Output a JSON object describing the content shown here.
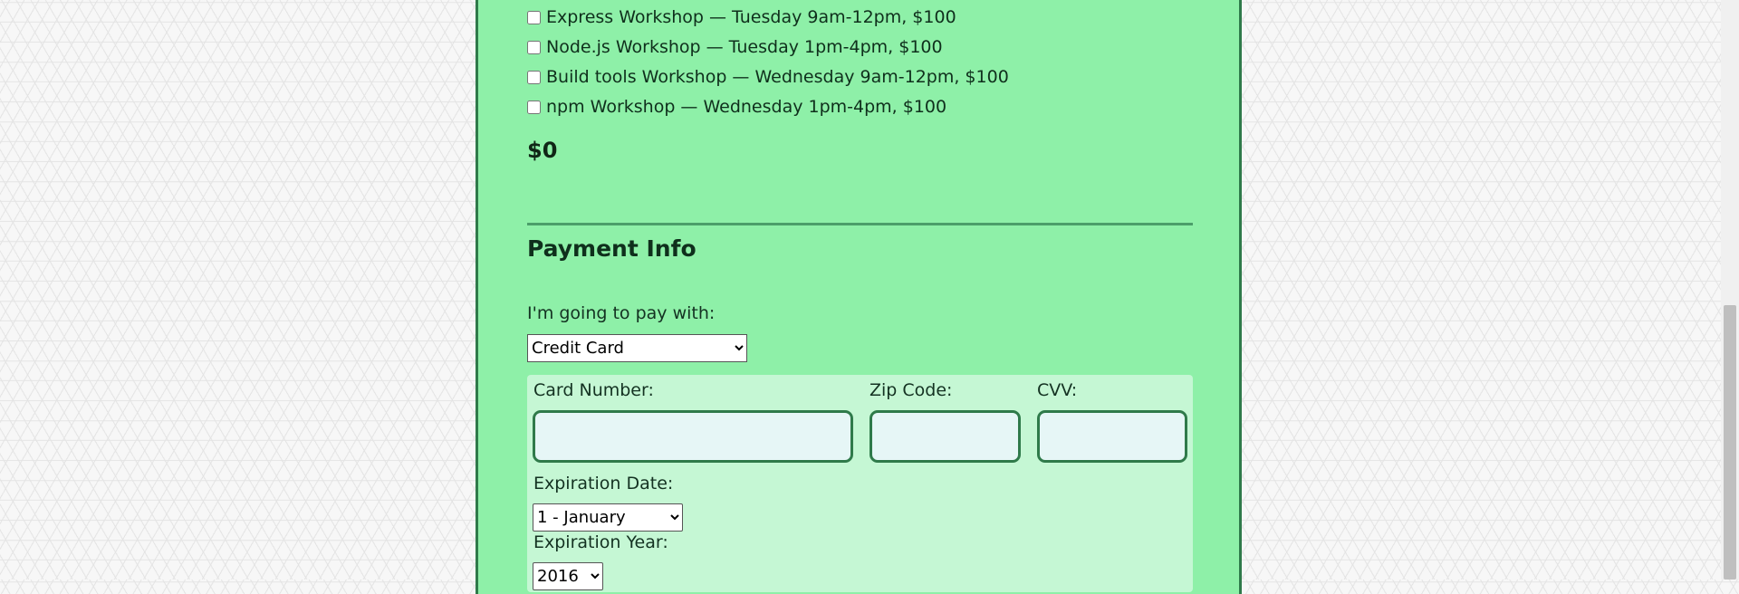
{
  "workshops": [
    {
      "label": "Express Workshop — Tuesday 9am-12pm, $100",
      "checked": false
    },
    {
      "label": "Node.js Workshop — Tuesday 1pm-4pm, $100",
      "checked": false
    },
    {
      "label": "Build tools Workshop — Wednesday 9am-12pm, $100",
      "checked": false
    },
    {
      "label": "npm Workshop — Wednesday 1pm-4pm, $100",
      "checked": false
    }
  ],
  "total": "$0",
  "payment": {
    "title": "Payment Info",
    "method_label": "I'm going to pay with:",
    "method_selected": "Credit Card",
    "card_number_label": "Card Number:",
    "zip_label": "Zip Code:",
    "cvv_label": "CVV:",
    "exp_date_label": "Expiration Date:",
    "exp_date_selected": "1 - January",
    "exp_year_label": "Expiration Year:",
    "exp_year_selected": "2016"
  },
  "colors": {
    "panel": "#8ef0a8",
    "card_box": "#c5f7d4",
    "accent_border": "#2f7a4a"
  }
}
